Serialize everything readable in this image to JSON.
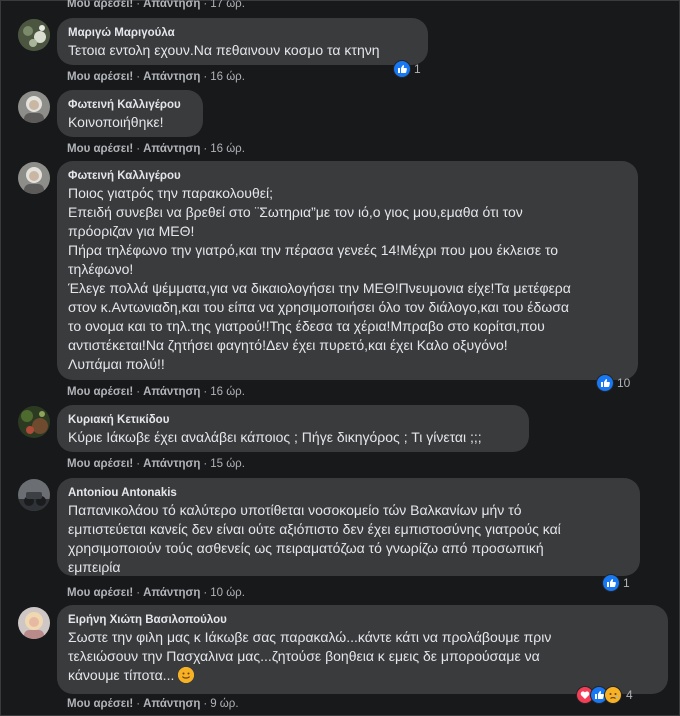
{
  "actions": {
    "like": "Μου αρέσει!",
    "reply": "Απάντηση",
    "dot": "·"
  },
  "top_partial": {
    "time": "17 ώρ."
  },
  "comments": [
    {
      "author": "Μαριγώ Μαριγούλα",
      "text": "Τετοια εντολη εχουν.Να πεθαινουν κοσμο τα κτηνη",
      "time": "16 ώρ.",
      "reactions": [
        "like-icon"
      ],
      "reaction_count": "1"
    },
    {
      "author": "Φωτεινή Καλλιγέρου",
      "text": "Κοινοποιήθηκε!",
      "time": "16 ώρ.",
      "reactions": [],
      "reaction_count": ""
    },
    {
      "author": "Φωτεινή Καλλιγέρου",
      "text": "Ποιος γιατρός την παρακολουθεί;\nΕπειδή συνεβει να βρεθεί στο ¨Σωτηρια”με τον ιό,ο γιος μου,εμαθα ότι τον\nπρόοριζαν για ΜΕΘ!\nΠήρα τηλέφωνο την γιατρό,και την πέρασα γενεές 14!Μέχρι που μου έκλεισε το\nτηλέφωνο!\nΈλεγε πολλά ψέμματα,για να δικαιολογήσει την ΜΕΘ!Πνευμονια είχε!Τα μετέφερα\nστον κ.Αντωνιαδη,και του είπα να χρησιμοποιήσει όλο τον διάλογο,και του έδωσα\nτο ονομα και το τηλ.της γιατρού!!Της έδεσα τα χέρια!Μπραβο στο κορίτσι,που\nαντιστέκεται!Να ζητήσει φαγητό!Δεν έχει πυρετό,και έχει Καλο οξυγόνο!\nΛυπάμαι πολύ!!",
      "time": "16 ώρ.",
      "reactions": [
        "like-icon"
      ],
      "reaction_count": "10"
    },
    {
      "author": "Κυριακή Κετικίδου",
      "text": "Κύριε Ιάκωβε έχει αναλάβει κάποιος ; Πήγε δικηγόρος ; Τι γίνεται ;;;",
      "time": "15 ώρ.",
      "reactions": [],
      "reaction_count": ""
    },
    {
      "author": "Antoniou Antonakis",
      "text": "Παπανικολάου τό καλύτερο υποτίθεται νοσοκομείο τών Βαλκανίων μήν τό\nεμπιστεύεται κανείς δεν είναι ούτε αξιόπιστο δεν έχει εμπιστοσύνης γιατρούς καί\nχρησιμοποιούν τούς ασθενείς ως πειραματόζωα τό γνωρίζω από προσωπική\nεμπειρία",
      "time": "10 ώρ.",
      "reactions": [
        "like-icon"
      ],
      "reaction_count": "1"
    },
    {
      "author": "Ειρήνη Χιώτη Βασιλοπούλου",
      "text": "Σωστε την φιλη μας κ Ιάκωβε σας παρακαλώ...κάντε κάτι να προλάβουμε πριν\nτελειώσουν την Πασχαλινα μας...ζητούσε βοηθεια κ εμεις δε μπορούσαμε να\nκάνουμε τίποτα...",
      "time": "9 ώρ.",
      "reactions": [
        "love-icon",
        "like-icon",
        "sad-icon"
      ],
      "reaction_count": "4"
    }
  ],
  "colors": {
    "background": "#18191a",
    "bubble": "#3a3b3c",
    "text": "#e4e6eb",
    "secondary": "#b0b3b8",
    "like": "#1877f2",
    "love": "#f33e58",
    "sad": "#f7b125"
  }
}
